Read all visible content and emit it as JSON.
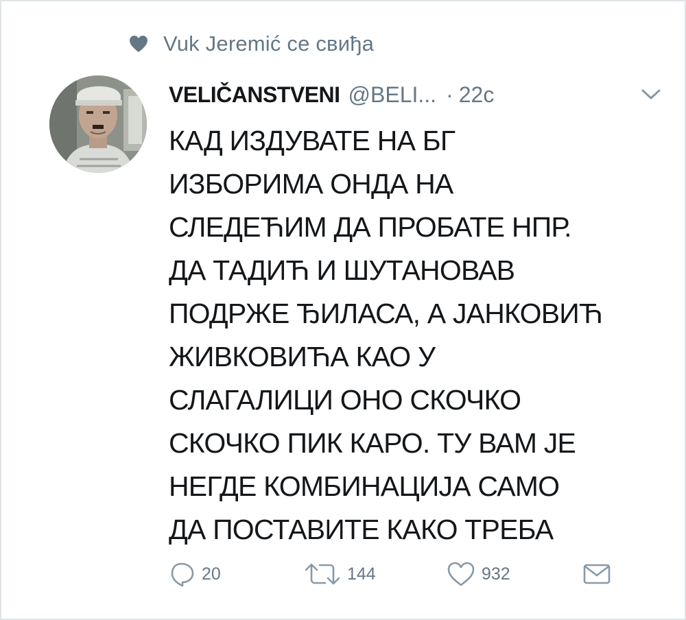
{
  "social_context": {
    "text": "Vuk Jeremić се свиђа",
    "icon": "heart-icon"
  },
  "tweet": {
    "author_name": "VELIČANSTVENI",
    "handle": "@BELI...",
    "separator": "·",
    "time": "22c",
    "lines": [
      "КАД ИЗДУВАТЕ НА БГ",
      "ИЗБОРИМА ОНДА НА",
      "СЛЕДЕЋИМ ДА ПРОБАТЕ НПР.",
      "ДА ТАДИЋ И ШУТАНОВАВ",
      "ПОДРЖЕ ЂИЛАСА, А ЈАНКОВИЋ",
      "ЖИВКОВИЋА КАО У",
      "СЛАГАЛИЦИ ОНО СКОЧКО",
      "СКОЧКО ПИК КАРО. ТУ ВАМ ЈЕ",
      "НЕГДЕ КОМБИНАЦИЈА САМО",
      "ДА ПОСТАВИТЕ КАКО ТРЕБА"
    ]
  },
  "actions": {
    "reply_count": "20",
    "retweet_count": "144",
    "like_count": "932"
  },
  "colors": {
    "text": "#14171a",
    "muted": "#657786",
    "border": "#dfe3e6"
  }
}
